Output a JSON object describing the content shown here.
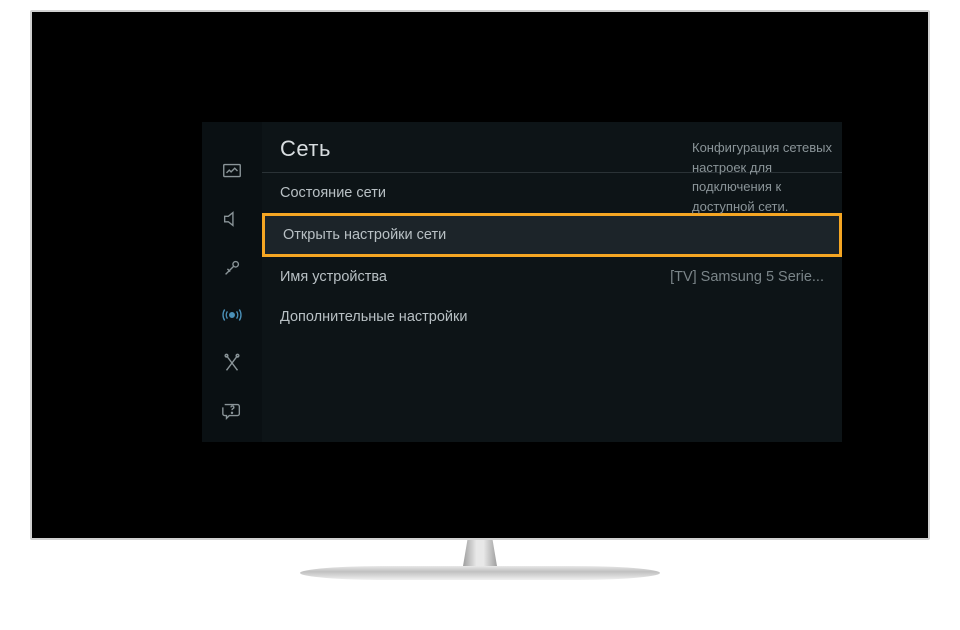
{
  "panel": {
    "title": "Сеть"
  },
  "menu": {
    "items": [
      {
        "label": "Состояние сети",
        "value": ""
      },
      {
        "label": "Открыть настройки сети",
        "value": ""
      },
      {
        "label": "Имя устройства",
        "value": "[TV] Samsung 5 Serie..."
      },
      {
        "label": "Дополнительные настройки",
        "value": ""
      }
    ]
  },
  "description": "Конфигурация сетевых настроек для подключения к доступной сети.",
  "sidebar": {
    "icons": [
      "picture",
      "sound",
      "broadcast",
      "network",
      "tools",
      "support"
    ]
  }
}
